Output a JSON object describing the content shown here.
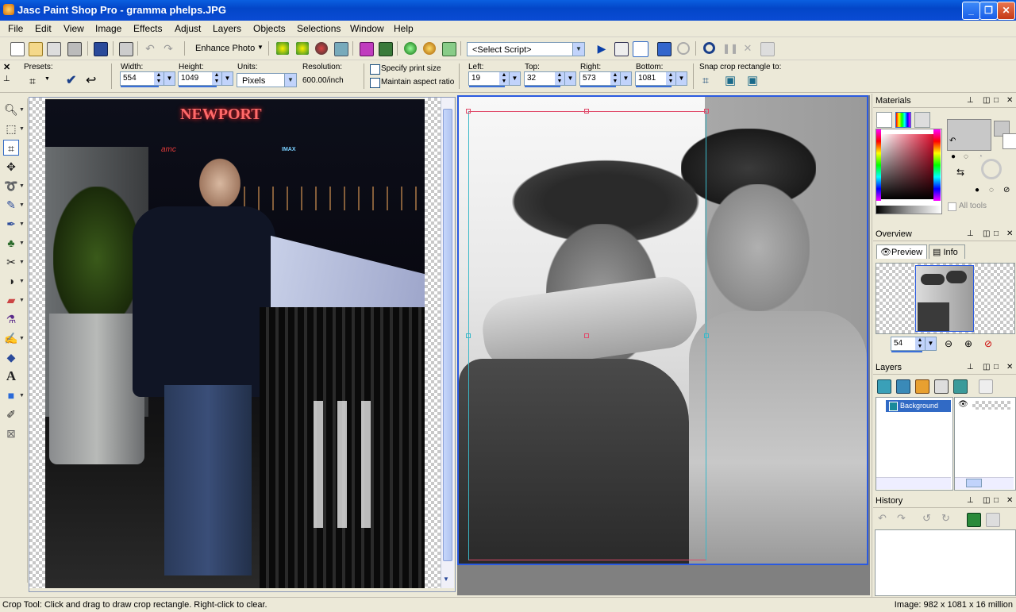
{
  "window": {
    "title": "Jasc Paint Shop Pro - gramma phelps.JPG"
  },
  "menu": [
    "File",
    "Edit",
    "View",
    "Image",
    "Effects",
    "Adjust",
    "Layers",
    "Objects",
    "Selections",
    "Window",
    "Help"
  ],
  "toolbar": {
    "enhance_photo": "Enhance Photo",
    "script_select": "<Select Script>"
  },
  "tool_options": {
    "presets_label": "Presets:",
    "width_label": "Width:",
    "width_value": "554",
    "height_label": "Height:",
    "height_value": "1049",
    "units_label": "Units:",
    "units_value": "Pixels",
    "resolution_label": "Resolution:",
    "resolution_value": "600.00/inch",
    "specify_print_size": "Specify print size",
    "maintain_aspect": "Maintain aspect ratio",
    "left_label": "Left:",
    "left_value": "19",
    "top_label": "Top:",
    "top_value": "32",
    "right_label": "Right:",
    "right_value": "573",
    "bottom_label": "Bottom:",
    "bottom_value": "1081",
    "snap_label": "Snap crop rectangle to:"
  },
  "photo_left": {
    "sign_text": "NEWPORT",
    "imax": "IMAX",
    "amc": "amc"
  },
  "panels": {
    "materials": {
      "title": "Materials",
      "all_tools": "All tools"
    },
    "overview": {
      "title": "Overview",
      "tab_preview": "Preview",
      "tab_info": "Info",
      "zoom": "54"
    },
    "layers": {
      "title": "Layers",
      "layer_name": "Background"
    },
    "history": {
      "title": "History"
    }
  },
  "status": {
    "left": "Crop Tool: Click and drag to draw crop rectangle. Right-click to clear.",
    "right": "Image:  982 x 1081 x 16 million"
  },
  "colors": {
    "accent": "#316ac5",
    "titlebar": "#0346c8"
  }
}
